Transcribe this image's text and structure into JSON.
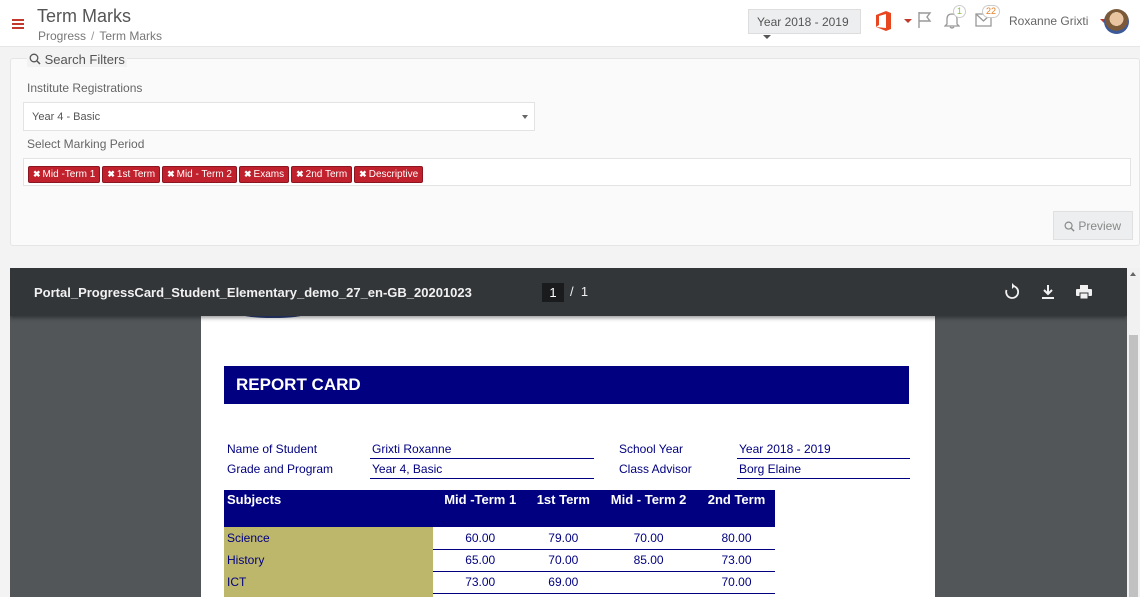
{
  "header": {
    "title": "Term Marks",
    "breadcrumb": [
      "Progress",
      "Term Marks"
    ],
    "year_selector": "Year 2018 - 2019",
    "notifications_count": "1",
    "messages_count": "22",
    "user_name": "Roxanne Grixti"
  },
  "filters": {
    "legend": "Search Filters",
    "registration_label": "Institute Registrations",
    "registration_value": "Year 4 - Basic",
    "period_label": "Select Marking Period",
    "periods": [
      "Mid -Term 1",
      "1st Term",
      "Mid - Term 2",
      "Exams",
      "2nd Term",
      "Descriptive"
    ],
    "preview_label": "Preview"
  },
  "viewer": {
    "file_name": "Portal_ProgressCard_Student_Elementary_demo_27_en-GB_20201023",
    "current_page": "1",
    "total_pages": "1"
  },
  "report": {
    "title": "REPORT CARD",
    "name_label": "Name of Student",
    "name_value": "Grixti Roxanne",
    "grade_label": "Grade and Program",
    "grade_value": "Year 4, Basic",
    "year_label": "School Year",
    "year_value": "Year 2018 - 2019",
    "advisor_label": "Class Advisor",
    "advisor_value": "Borg Elaine",
    "columns": [
      "Subjects",
      "Mid -Term 1",
      "1st Term",
      "Mid - Term 2",
      "2nd Term"
    ],
    "rows": [
      {
        "subject": "Science",
        "marks": [
          "60.00",
          "79.00",
          "70.00",
          "80.00"
        ]
      },
      {
        "subject": "History",
        "marks": [
          "65.00",
          "70.00",
          "85.00",
          "73.00"
        ]
      },
      {
        "subject": "ICT",
        "marks": [
          "73.00",
          "69.00",
          "",
          "70.00"
        ]
      }
    ]
  },
  "colors": {
    "accent_red": "#c0212c",
    "report_navy": "#000080",
    "subject_khaki": "#bdb76b"
  }
}
